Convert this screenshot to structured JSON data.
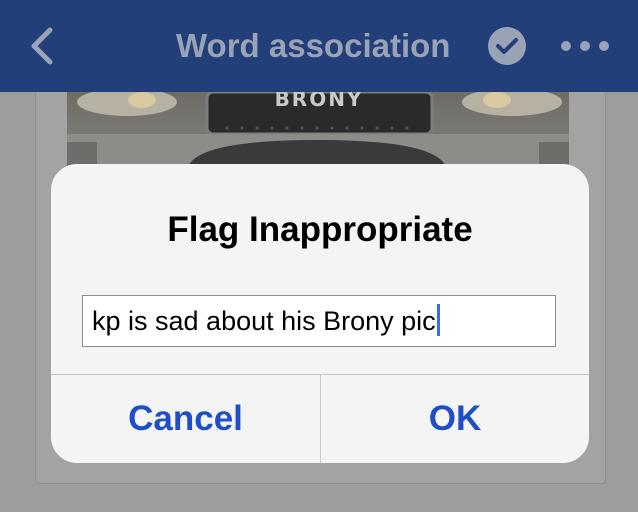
{
  "navbar": {
    "title": "Word association",
    "background_color": "#223f7a",
    "icons": [
      "chevron-left-icon",
      "verified-check-icon",
      "more-horizontal-icon"
    ]
  },
  "post": {
    "image_text": "BRONY"
  },
  "alert": {
    "title": "Flag Inappropriate",
    "input_value": "kp is sad about his Brony pic",
    "cancel_label": "Cancel",
    "ok_label": "OK",
    "button_color": "#1f4fc4"
  }
}
